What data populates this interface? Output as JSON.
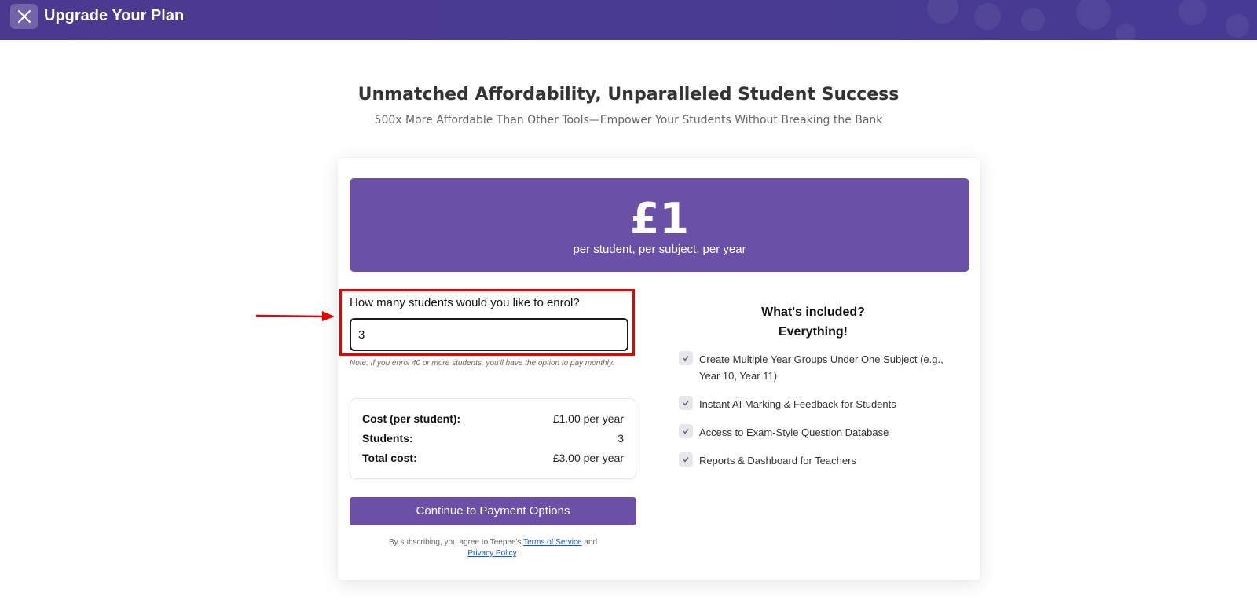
{
  "header": {
    "title": "Upgrade Your Plan",
    "close_icon": "close-icon"
  },
  "hero": {
    "headline": "Unmatched Affordability, Unparalleled Student Success",
    "subheadline": "500x More Affordable Than Other Tools—Empower Your Students Without Breaking the Bank"
  },
  "pricing": {
    "price": "£1",
    "caption": "per student, per subject, per year"
  },
  "enrol": {
    "question": "How many students would you like to enrol?",
    "input_value": "3",
    "note": "Note: If you enrol 40 or more students, you'll have the option to pay monthly."
  },
  "summary": {
    "rows": [
      {
        "label": "Cost (per student):",
        "value": "£1.00 per year"
      },
      {
        "label": "Students:",
        "value": "3"
      },
      {
        "label": "Total cost:",
        "value": "£3.00 per year"
      }
    ]
  },
  "cta": {
    "label": "Continue to Payment Options"
  },
  "legal": {
    "prefix": "By subscribing, you agree to Teepee's",
    "terms": "Terms of Service",
    "and": "and",
    "privacy": "Privacy Policy",
    "suffix": "."
  },
  "included": {
    "title_line1": "What's included?",
    "title_line2": "Everything!",
    "features": [
      "Create Multiple Year Groups Under One Subject (e.g., Year 10, Year 11)",
      "Instant AI Marking & Feedback for Students",
      "Access to Exam-Style Question Database",
      "Reports & Dashboard for Teachers"
    ]
  },
  "colors": {
    "header_bg": "#493b92",
    "accent": "#6a50a6",
    "highlight": "#e60000",
    "link": "#1a56c9"
  }
}
